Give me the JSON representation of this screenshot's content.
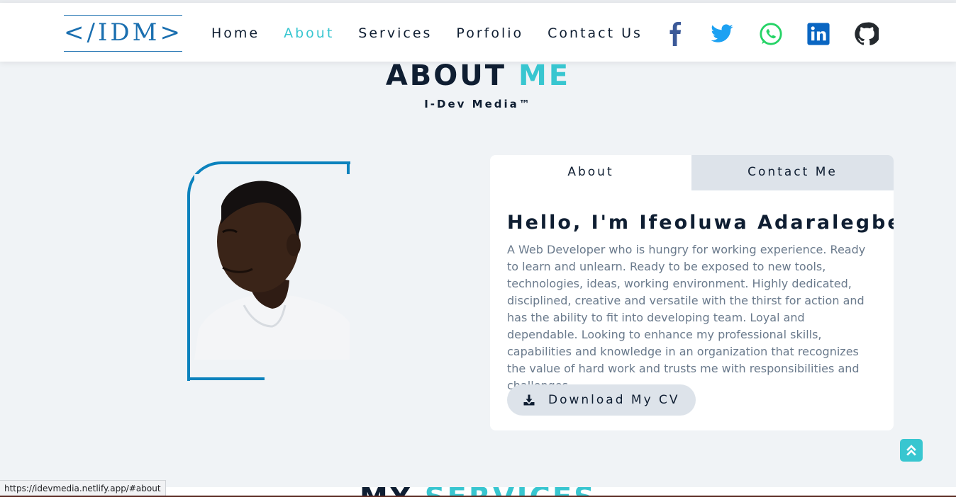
{
  "header": {
    "logo_text": "</IDM>",
    "nav": [
      {
        "label": "Home"
      },
      {
        "label": "About"
      },
      {
        "label": "Services"
      },
      {
        "label": "Porfolio"
      },
      {
        "label": "Contact Us"
      }
    ],
    "social_icons": [
      "facebook-icon",
      "twitter-icon",
      "whatsapp-icon",
      "linkedin-icon",
      "github-icon"
    ]
  },
  "about": {
    "title_main": "ABOUT",
    "title_accent": "ME",
    "subtitle": "I-Dev Media™",
    "tabs": [
      {
        "label": "About"
      },
      {
        "label": "Contact Me"
      }
    ],
    "greeting": "Hello, I'm Ifeoluwa Adaralegbe",
    "bio": "A Web Developer who is hungry for working experience. Ready to learn and unlearn. Ready to be exposed to new tools, technologies, ideas, working environment. Highly dedicated, disciplined, creative and versatile with the thirst for action and has the ability to fit into developing team. Loyal and dependable. Looking to enhance my professional skills, capabilities and knowledge in an organization that recognizes the value of hard work and trusts me with responsibilities and challenges.",
    "cv_button": "Download My CV"
  },
  "next_section": {
    "title_main": "MY",
    "title_accent": "SERVICES"
  },
  "status_bar": {
    "url": "https://idevmedia.netlify.app/#about"
  },
  "colors": {
    "accent": "#38c6d0",
    "brand_blue": "#0b82bd",
    "dark": "#0f1e32",
    "background": "#f0f3f6",
    "facebook": "#3b5998",
    "twitter": "#1da1f2",
    "whatsapp": "#25d366",
    "linkedin": "#0a66c2",
    "github": "#24292e"
  }
}
